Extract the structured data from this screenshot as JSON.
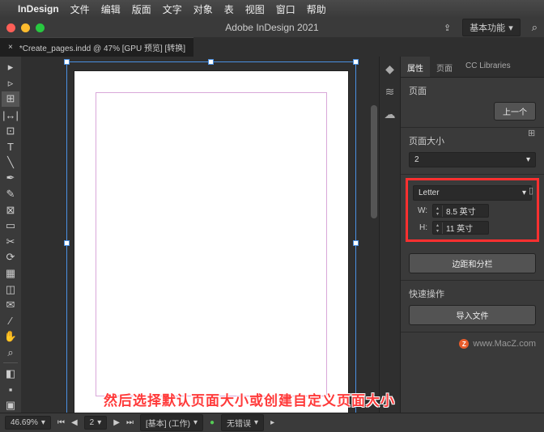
{
  "menubar": {
    "app": "InDesign",
    "items": [
      "文件",
      "编辑",
      "版面",
      "文字",
      "对象",
      "表",
      "视图",
      "窗口",
      "帮助"
    ]
  },
  "window": {
    "title": "Adobe InDesign 2021",
    "workspace": "基本功能"
  },
  "tab": {
    "name": "*Create_pages.indd @ 47% [GPU 预览] [转换]"
  },
  "panel": {
    "tabs": {
      "properties": "属性",
      "pages": "页面",
      "cc": "CC Libraries"
    },
    "section_page": "页面",
    "prev_btn": "上一个",
    "section_size": "页面大小",
    "count": "2",
    "preset": "Letter",
    "w_label": "W:",
    "w_value": "8.5 英寸",
    "h_label": "H:",
    "h_value": "11 英寸",
    "margins_btn": "边距和分栏",
    "quick": "快速操作",
    "import_btn": "导入文件"
  },
  "watermark": "www.MacZ.com",
  "status": {
    "zoom": "46.69%",
    "nav": "2",
    "work": "[基本] (工作)",
    "err": "无错误"
  },
  "caption": "然后选择默认页面大小或创建自定义页面大小",
  "chart_data": null
}
